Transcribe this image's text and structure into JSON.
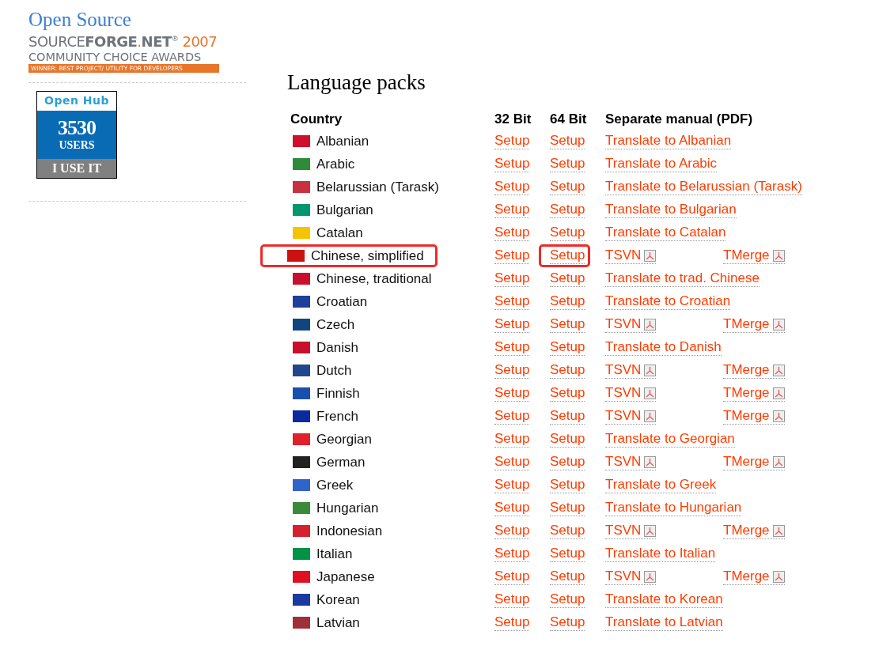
{
  "sidebar": {
    "award": {
      "line1": "Open Source",
      "brand_light": "SOURCE",
      "brand_bold": "FORGE",
      "brand_dot": ".",
      "brand_net": "NET",
      "brand_mark": "®",
      "year": "2007",
      "line3": "COMMUNITY CHOICE AWARDS",
      "banner": "WINNER: BEST PROJECT/ UTILITY FOR DEVELOPERS"
    },
    "badge": {
      "title": "Open Hub",
      "count": "3530",
      "unit": "USERS",
      "action": "I USE IT"
    }
  },
  "title": "Language packs",
  "columns": [
    "Country",
    "32 Bit",
    "64 Bit",
    "Separate manual (PDF)"
  ],
  "rows": [
    {
      "country": "Albanian",
      "color": "#d0102a",
      "setup32": "Setup",
      "setup64": "Setup",
      "manual": {
        "kind": "translate",
        "text": "Translate to Albanian"
      }
    },
    {
      "country": "Arabic",
      "color": "#2e8b3a",
      "setup32": "Setup",
      "setup64": "Setup",
      "manual": {
        "kind": "translate",
        "text": "Translate to Arabic"
      }
    },
    {
      "country": "Belarussian (Tarask)",
      "color": "#c8313e",
      "setup32": "Setup",
      "setup64": "Setup",
      "manual": {
        "kind": "translate",
        "text": "Translate to Belarussian (Tarask)"
      }
    },
    {
      "country": "Bulgarian",
      "color": "#00966e",
      "setup32": "Setup",
      "setup64": "Setup",
      "manual": {
        "kind": "translate",
        "text": "Translate to Bulgarian"
      }
    },
    {
      "country": "Catalan",
      "color": "#f5c400",
      "setup32": "Setup",
      "setup64": "Setup",
      "manual": {
        "kind": "translate",
        "text": "Translate to Catalan"
      }
    },
    {
      "country": "Chinese, simplified",
      "color": "#cc1111",
      "highlight_country": true,
      "highlight_64": true,
      "setup32": "Setup",
      "setup64": "Setup",
      "manual": {
        "kind": "pdf",
        "links": [
          "TSVN",
          "TMerge"
        ]
      }
    },
    {
      "country": "Chinese, traditional",
      "color": "#c8102e",
      "setup32": "Setup",
      "setup64": "Setup",
      "manual": {
        "kind": "translate",
        "text": "Translate to trad. Chinese"
      }
    },
    {
      "country": "Croatian",
      "color": "#1e3f9a",
      "setup32": "Setup",
      "setup64": "Setup",
      "manual": {
        "kind": "translate",
        "text": "Translate to Croatian"
      }
    },
    {
      "country": "Czech",
      "color": "#11457e",
      "setup32": "Setup",
      "setup64": "Setup",
      "manual": {
        "kind": "pdf",
        "links": [
          "TSVN",
          "TMerge"
        ]
      }
    },
    {
      "country": "Danish",
      "color": "#c8102e",
      "setup32": "Setup",
      "setup64": "Setup",
      "manual": {
        "kind": "translate",
        "text": "Translate to Danish"
      }
    },
    {
      "country": "Dutch",
      "color": "#21468b",
      "setup32": "Setup",
      "setup64": "Setup",
      "manual": {
        "kind": "pdf",
        "links": [
          "TSVN",
          "TMerge"
        ]
      }
    },
    {
      "country": "Finnish",
      "color": "#1a4fb0",
      "setup32": "Setup",
      "setup64": "Setup",
      "manual": {
        "kind": "pdf",
        "links": [
          "TSVN",
          "TMerge"
        ]
      }
    },
    {
      "country": "French",
      "color": "#0b2a9c",
      "setup32": "Setup",
      "setup64": "Setup",
      "manual": {
        "kind": "pdf",
        "links": [
          "TSVN",
          "TMerge"
        ]
      }
    },
    {
      "country": "Georgian",
      "color": "#e0202a",
      "setup32": "Setup",
      "setup64": "Setup",
      "manual": {
        "kind": "translate",
        "text": "Translate to Georgian"
      }
    },
    {
      "country": "German",
      "color": "#222222",
      "setup32": "Setup",
      "setup64": "Setup",
      "manual": {
        "kind": "pdf",
        "links": [
          "TSVN",
          "TMerge"
        ]
      }
    },
    {
      "country": "Greek",
      "color": "#2f64c8",
      "setup32": "Setup",
      "setup64": "Setup",
      "manual": {
        "kind": "translate",
        "text": "Translate to Greek"
      }
    },
    {
      "country": "Hungarian",
      "color": "#3a8a3a",
      "setup32": "Setup",
      "setup64": "Setup",
      "manual": {
        "kind": "translate",
        "text": "Translate to Hungarian"
      }
    },
    {
      "country": "Indonesian",
      "color": "#d62030",
      "setup32": "Setup",
      "setup64": "Setup",
      "manual": {
        "kind": "pdf",
        "links": [
          "TSVN",
          "TMerge"
        ]
      }
    },
    {
      "country": "Italian",
      "color": "#009246",
      "setup32": "Setup",
      "setup64": "Setup",
      "manual": {
        "kind": "translate",
        "text": "Translate to Italian"
      }
    },
    {
      "country": "Japanese",
      "color": "#e01020",
      "setup32": "Setup",
      "setup64": "Setup",
      "manual": {
        "kind": "pdf",
        "links": [
          "TSVN",
          "TMerge"
        ]
      }
    },
    {
      "country": "Korean",
      "color": "#1a3aa0",
      "setup32": "Setup",
      "setup64": "Setup",
      "manual": {
        "kind": "translate",
        "text": "Translate to Korean"
      }
    },
    {
      "country": "Latvian",
      "color": "#9e3039",
      "setup32": "Setup",
      "setup64": "Setup",
      "manual": {
        "kind": "translate",
        "text": "Translate to Latvian"
      }
    }
  ]
}
